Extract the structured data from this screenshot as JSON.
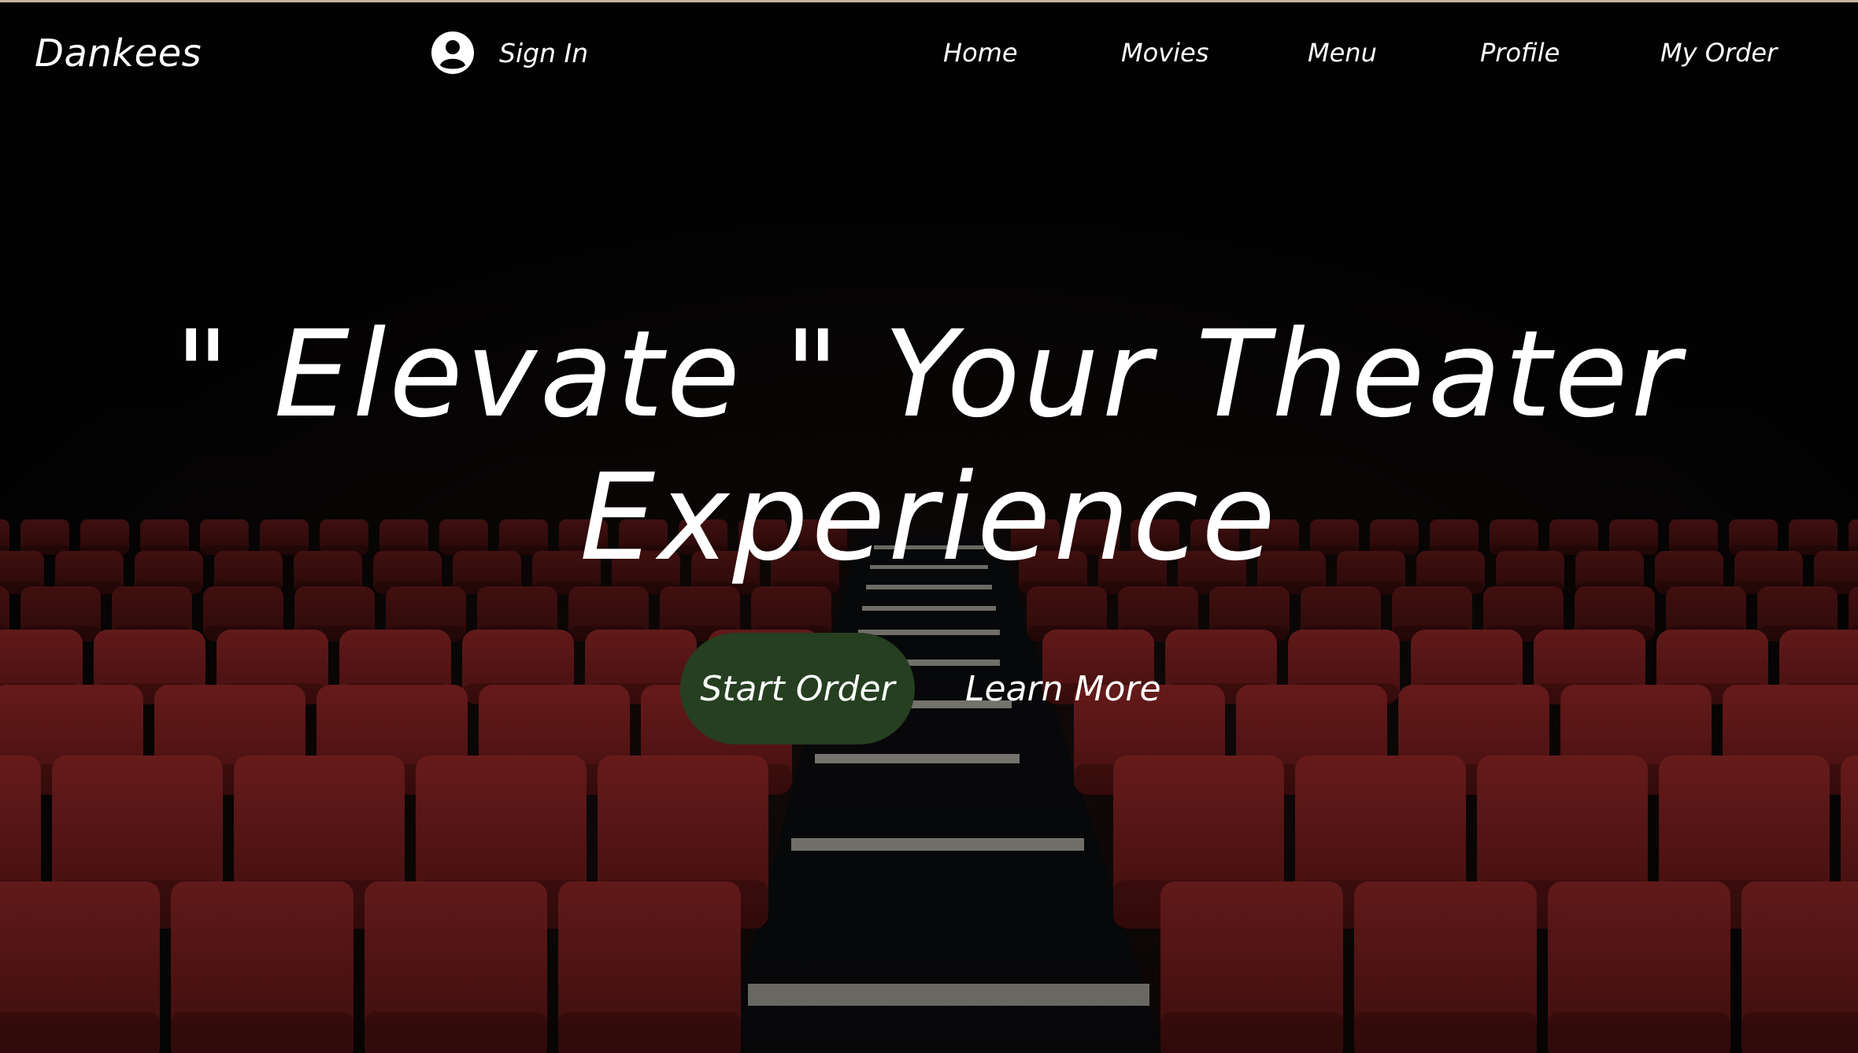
{
  "brand": {
    "name": "Dankees"
  },
  "header": {
    "sign_in_label": "Sign In",
    "user_icon": "user-circle-icon"
  },
  "nav": {
    "items": [
      {
        "label": "Home"
      },
      {
        "label": "Movies"
      },
      {
        "label": "Menu"
      },
      {
        "label": "Profile"
      },
      {
        "label": "My Order"
      }
    ]
  },
  "hero": {
    "title_line1": "\" Elevate \" Your Theater",
    "title_line2": "Experience",
    "primary_cta": "Start Order",
    "secondary_cta": "Learn More"
  },
  "colors": {
    "background": "#050505",
    "seat_red": "#7a1a1a",
    "primary_button": "#253f20",
    "text": "#ffffff",
    "top_border": "#c8b79a"
  }
}
